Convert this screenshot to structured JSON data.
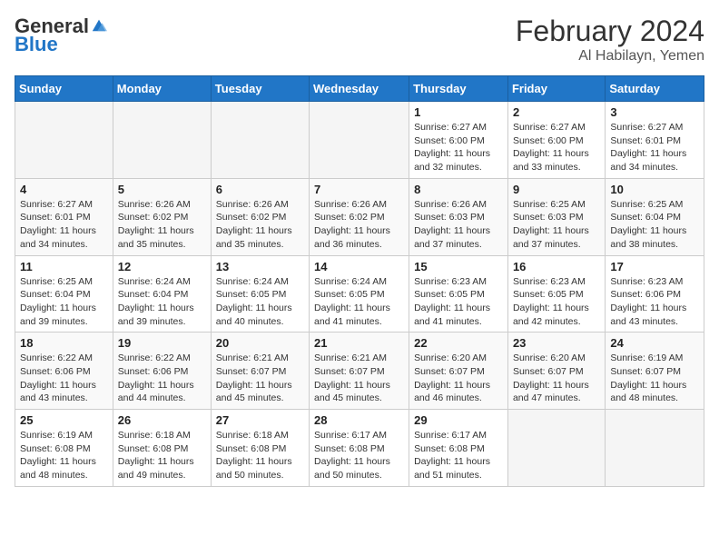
{
  "logo": {
    "general": "General",
    "blue": "Blue"
  },
  "title": {
    "month_year": "February 2024",
    "location": "Al Habilayn, Yemen"
  },
  "days_of_week": [
    "Sunday",
    "Monday",
    "Tuesday",
    "Wednesday",
    "Thursday",
    "Friday",
    "Saturday"
  ],
  "weeks": [
    [
      {
        "day": "",
        "info": ""
      },
      {
        "day": "",
        "info": ""
      },
      {
        "day": "",
        "info": ""
      },
      {
        "day": "",
        "info": ""
      },
      {
        "day": "1",
        "info": "Sunrise: 6:27 AM\nSunset: 6:00 PM\nDaylight: 11 hours and 32 minutes."
      },
      {
        "day": "2",
        "info": "Sunrise: 6:27 AM\nSunset: 6:00 PM\nDaylight: 11 hours and 33 minutes."
      },
      {
        "day": "3",
        "info": "Sunrise: 6:27 AM\nSunset: 6:01 PM\nDaylight: 11 hours and 34 minutes."
      }
    ],
    [
      {
        "day": "4",
        "info": "Sunrise: 6:27 AM\nSunset: 6:01 PM\nDaylight: 11 hours and 34 minutes."
      },
      {
        "day": "5",
        "info": "Sunrise: 6:26 AM\nSunset: 6:02 PM\nDaylight: 11 hours and 35 minutes."
      },
      {
        "day": "6",
        "info": "Sunrise: 6:26 AM\nSunset: 6:02 PM\nDaylight: 11 hours and 35 minutes."
      },
      {
        "day": "7",
        "info": "Sunrise: 6:26 AM\nSunset: 6:02 PM\nDaylight: 11 hours and 36 minutes."
      },
      {
        "day": "8",
        "info": "Sunrise: 6:26 AM\nSunset: 6:03 PM\nDaylight: 11 hours and 37 minutes."
      },
      {
        "day": "9",
        "info": "Sunrise: 6:25 AM\nSunset: 6:03 PM\nDaylight: 11 hours and 37 minutes."
      },
      {
        "day": "10",
        "info": "Sunrise: 6:25 AM\nSunset: 6:04 PM\nDaylight: 11 hours and 38 minutes."
      }
    ],
    [
      {
        "day": "11",
        "info": "Sunrise: 6:25 AM\nSunset: 6:04 PM\nDaylight: 11 hours and 39 minutes."
      },
      {
        "day": "12",
        "info": "Sunrise: 6:24 AM\nSunset: 6:04 PM\nDaylight: 11 hours and 39 minutes."
      },
      {
        "day": "13",
        "info": "Sunrise: 6:24 AM\nSunset: 6:05 PM\nDaylight: 11 hours and 40 minutes."
      },
      {
        "day": "14",
        "info": "Sunrise: 6:24 AM\nSunset: 6:05 PM\nDaylight: 11 hours and 41 minutes."
      },
      {
        "day": "15",
        "info": "Sunrise: 6:23 AM\nSunset: 6:05 PM\nDaylight: 11 hours and 41 minutes."
      },
      {
        "day": "16",
        "info": "Sunrise: 6:23 AM\nSunset: 6:05 PM\nDaylight: 11 hours and 42 minutes."
      },
      {
        "day": "17",
        "info": "Sunrise: 6:23 AM\nSunset: 6:06 PM\nDaylight: 11 hours and 43 minutes."
      }
    ],
    [
      {
        "day": "18",
        "info": "Sunrise: 6:22 AM\nSunset: 6:06 PM\nDaylight: 11 hours and 43 minutes."
      },
      {
        "day": "19",
        "info": "Sunrise: 6:22 AM\nSunset: 6:06 PM\nDaylight: 11 hours and 44 minutes."
      },
      {
        "day": "20",
        "info": "Sunrise: 6:21 AM\nSunset: 6:07 PM\nDaylight: 11 hours and 45 minutes."
      },
      {
        "day": "21",
        "info": "Sunrise: 6:21 AM\nSunset: 6:07 PM\nDaylight: 11 hours and 45 minutes."
      },
      {
        "day": "22",
        "info": "Sunrise: 6:20 AM\nSunset: 6:07 PM\nDaylight: 11 hours and 46 minutes."
      },
      {
        "day": "23",
        "info": "Sunrise: 6:20 AM\nSunset: 6:07 PM\nDaylight: 11 hours and 47 minutes."
      },
      {
        "day": "24",
        "info": "Sunrise: 6:19 AM\nSunset: 6:07 PM\nDaylight: 11 hours and 48 minutes."
      }
    ],
    [
      {
        "day": "25",
        "info": "Sunrise: 6:19 AM\nSunset: 6:08 PM\nDaylight: 11 hours and 48 minutes."
      },
      {
        "day": "26",
        "info": "Sunrise: 6:18 AM\nSunset: 6:08 PM\nDaylight: 11 hours and 49 minutes."
      },
      {
        "day": "27",
        "info": "Sunrise: 6:18 AM\nSunset: 6:08 PM\nDaylight: 11 hours and 50 minutes."
      },
      {
        "day": "28",
        "info": "Sunrise: 6:17 AM\nSunset: 6:08 PM\nDaylight: 11 hours and 50 minutes."
      },
      {
        "day": "29",
        "info": "Sunrise: 6:17 AM\nSunset: 6:08 PM\nDaylight: 11 hours and 51 minutes."
      },
      {
        "day": "",
        "info": ""
      },
      {
        "day": "",
        "info": ""
      }
    ]
  ]
}
